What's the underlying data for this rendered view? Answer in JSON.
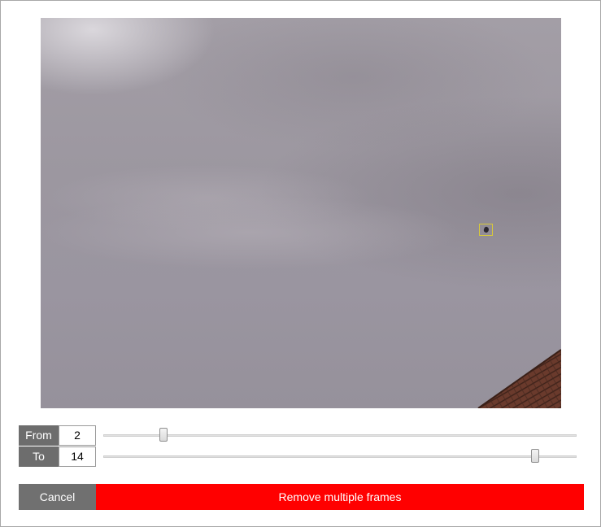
{
  "colors": {
    "label_background": "#6d6d6d",
    "cancel_background": "#707070",
    "remove_background": "#ff0000",
    "detection_box": "#d8c93a"
  },
  "preview": {
    "image": "overcast sky with roof tiles in lower right corner",
    "detection_marker": "yellow box around small dark object"
  },
  "range": {
    "from": {
      "label": "From",
      "value": "2",
      "slider_fraction": 0.12
    },
    "to": {
      "label": "To",
      "value": "14",
      "slider_fraction": 0.92
    }
  },
  "buttons": {
    "cancel_label": "Cancel",
    "remove_label": "Remove multiple frames"
  }
}
